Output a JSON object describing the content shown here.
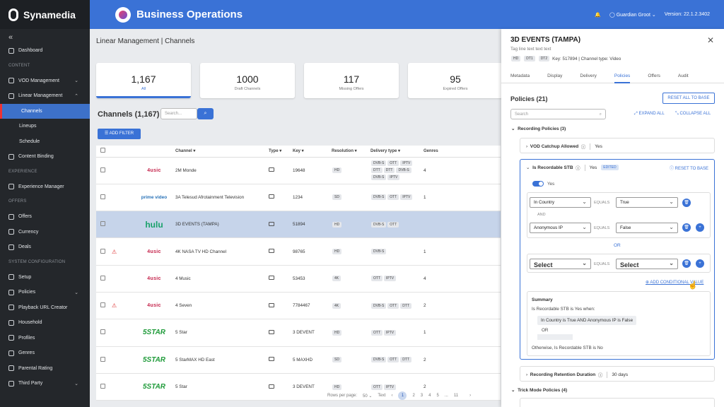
{
  "app": {
    "brand": "Synamedia",
    "title": "Business Operations",
    "user": "Guardian Groot",
    "version": "Version: 22.1.2.3402"
  },
  "sidebar": {
    "sections": [
      {
        "label": "",
        "items": [
          {
            "label": "Dashboard"
          }
        ]
      },
      {
        "label": "CONTENT",
        "items": [
          {
            "label": "VOD Management",
            "chev": "⌄"
          },
          {
            "label": "Linear Management",
            "chev": "⌃"
          },
          {
            "label": "Channels",
            "sub": true,
            "active": true
          },
          {
            "label": "Lineups",
            "sub": true
          },
          {
            "label": "Schedule",
            "sub": true
          },
          {
            "label": "Content Binding"
          }
        ]
      },
      {
        "label": "EXPERIENCE",
        "items": [
          {
            "label": "Experience Manager"
          }
        ]
      },
      {
        "label": "OFFERS",
        "items": [
          {
            "label": "Offers"
          },
          {
            "label": "Currency"
          },
          {
            "label": "Deals"
          }
        ]
      },
      {
        "label": "SYSTEM CONFIGURATION",
        "items": [
          {
            "label": "Setup"
          },
          {
            "label": "Policies",
            "chev": "⌄"
          },
          {
            "label": "Playback URL Creator"
          },
          {
            "label": "Household"
          },
          {
            "label": "Profiles"
          },
          {
            "label": "Genres"
          },
          {
            "label": "Parental Rating"
          },
          {
            "label": "Third Party",
            "chev": "⌄"
          }
        ]
      }
    ]
  },
  "main": {
    "breadcrumb": "Linear Management  |  Channels",
    "cards": [
      {
        "value": "1,167",
        "label": "All",
        "active": true
      },
      {
        "value": "1000",
        "label": "Draft Channels"
      },
      {
        "value": "117",
        "label": "Missing Offers"
      },
      {
        "value": "95",
        "label": "Expired Offers"
      }
    ],
    "channels_title": "Channels (1,167)",
    "search_placeholder": "Search...",
    "add_filter": "ADD FILTER",
    "columns": [
      "Channel",
      "Type",
      "Key",
      "Resolution",
      "Delivery type",
      "Genres"
    ],
    "rows": [
      {
        "logo": "4usic",
        "logo_type": "music",
        "warn": false,
        "channel": "2M Monde",
        "key": "19648",
        "res": "HD",
        "delivery": [
          "DVB-S",
          "OTT",
          "IPTV",
          "DTT",
          "DTT",
          "DVB-S",
          "DVB-S",
          "IPTV"
        ],
        "genres": "4"
      },
      {
        "logo": "prime video",
        "logo_type": "prime",
        "warn": false,
        "channel": "3A Telesud Afrotainment Television",
        "key": "1234",
        "res": "SD",
        "delivery": [
          "DVB-S",
          "OTT",
          "IPTV"
        ],
        "genres": "1"
      },
      {
        "logo": "hulu",
        "logo_type": "hulu",
        "warn": false,
        "channel": "3D EVENTS (TAMPA)",
        "key": "51894",
        "res": "HD",
        "delivery": [
          "DVB-S",
          "OTT"
        ],
        "genres": "",
        "selected": true
      },
      {
        "logo": "4usic",
        "logo_type": "music",
        "warn": true,
        "channel": "4K NASA TV HD Channel",
        "key": "98765",
        "res": "HD",
        "delivery": [
          "DVB-S"
        ],
        "genres": "1"
      },
      {
        "logo": "4usic",
        "logo_type": "music",
        "warn": false,
        "channel": "4 Music",
        "key": "53453",
        "res": "4K",
        "delivery": [
          "OTT",
          "IPTV"
        ],
        "genres": "4"
      },
      {
        "logo": "4usic",
        "logo_type": "music",
        "warn": true,
        "channel": "4 Seven",
        "key": "7784467",
        "res": "4K",
        "delivery": [
          "DVB-S",
          "OTT",
          "DTT"
        ],
        "genres": "2"
      },
      {
        "logo": "5STAR",
        "logo_type": "star",
        "warn": false,
        "channel": "5 Star",
        "key": "3 DEVENT",
        "res": "HD",
        "delivery": [
          "OTT",
          "IPTV"
        ],
        "genres": "1"
      },
      {
        "logo": "5STAR",
        "logo_type": "star",
        "warn": false,
        "channel": "5 StarMAX HD East",
        "key": "5 MAXHD",
        "res": "SD",
        "delivery": [
          "DVB-S",
          "OTT",
          "DTT"
        ],
        "genres": "2"
      },
      {
        "logo": "5STAR",
        "logo_type": "star",
        "warn": false,
        "channel": "5 Star",
        "key": "3 DEVENT",
        "res": "HD",
        "delivery": [
          "OTT",
          "IPTV"
        ],
        "genres": "2"
      }
    ],
    "pager": {
      "rows_label": "Rows per page:",
      "rows_value": "50",
      "prev": "Text",
      "pages": [
        "1",
        "2",
        "3",
        "4",
        "5",
        "...",
        "11"
      ],
      "current": "1"
    }
  },
  "panel": {
    "title": "3D EVENTS (TAMPA)",
    "tagline": "Tag line text text text",
    "chips": [
      "HD",
      "DT1",
      "DT2"
    ],
    "key_info": "Key: 517894 | Channel type: Video",
    "tabs": [
      "Metadata",
      "Display",
      "Delivery",
      "Policies",
      "Offers",
      "Audit"
    ],
    "active_tab": "Policies",
    "heading": "Policies (21)",
    "reset_all": "RESET ALL TO BASE",
    "search_placeholder": "Search",
    "expand_all": "EXPAND ALL",
    "collapse_all": "COLLAPSE ALL",
    "recording_title": "Recording Policies (3)",
    "vod": {
      "label": "VOD Catchup Allowed",
      "value": "Yes"
    },
    "stb": {
      "label": "Is Recordable STB",
      "value": "Yes",
      "badge": "EDITED",
      "reset": "RESET TO BASE",
      "toggle_label": "Yes"
    },
    "cond1": {
      "field1": "In Country",
      "op1": "EQUALS",
      "val1": "True",
      "and": "AND",
      "field2": "Anonymous IP",
      "op2": "EQUALS",
      "val2": "False"
    },
    "or_label": "OR",
    "cond2": {
      "field": "Select",
      "op": "EQUALS",
      "val": "Select"
    },
    "add_cond": "ADD CONDITIONAL VALUE",
    "summary": {
      "title": "Summary",
      "line1": "Is Recordable STB is Yes when:",
      "pill": "In Country is True  AND  Anonymous IP is False",
      "or": "OR",
      "otherwise": "Otherwise, Is Recordable STB is No"
    },
    "retention": {
      "label": "Recording Retention Duration",
      "value": "30 days"
    },
    "trick_title": "Trick Mode Policies (4)"
  }
}
